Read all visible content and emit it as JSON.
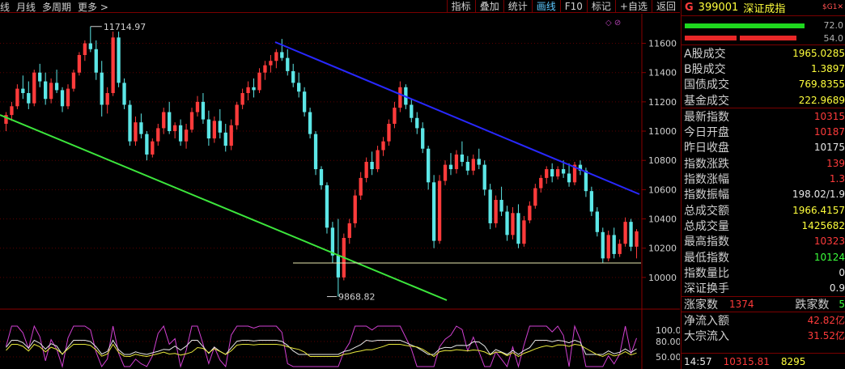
{
  "toolbar": {
    "left_items": [
      "线",
      "月线",
      "多周期",
      "更多 >"
    ],
    "right_buttons": [
      "指标",
      "叠加",
      "统计",
      "画线",
      "F10",
      "标记",
      "+自选",
      "返回"
    ],
    "active_button": "画线"
  },
  "chart": {
    "corner_glyph": "◇ ⊘",
    "high_label": "11714.97",
    "low_label": "9868.82",
    "price_axis": [
      "11600",
      "11400",
      "11200",
      "11000",
      "10800",
      "10600",
      "10400",
      "10200",
      "10000"
    ],
    "indicator_axis": [
      "100.00",
      "80.00",
      "50.00"
    ],
    "colors": {
      "up": "#ff3b3b",
      "down": "#5ce6e6",
      "trend_blue": "#2828ff",
      "trend_green": "#3ce63c",
      "support": "#e8e8b0"
    }
  },
  "chart_data": {
    "type": "candlestick",
    "title": "",
    "ylim": [
      9800,
      11780
    ],
    "candles": [
      {
        "o": 11050,
        "h": 11130,
        "l": 11000,
        "c": 11110
      },
      {
        "o": 11110,
        "h": 11200,
        "l": 11070,
        "c": 11170
      },
      {
        "o": 11170,
        "h": 11320,
        "l": 11150,
        "c": 11290
      },
      {
        "o": 11290,
        "h": 11380,
        "l": 11220,
        "c": 11260
      },
      {
        "o": 11260,
        "h": 11340,
        "l": 11150,
        "c": 11190
      },
      {
        "o": 11190,
        "h": 11420,
        "l": 11170,
        "c": 11400
      },
      {
        "o": 11400,
        "h": 11460,
        "l": 11300,
        "c": 11340
      },
      {
        "o": 11340,
        "h": 11400,
        "l": 11180,
        "c": 11220
      },
      {
        "o": 11220,
        "h": 11360,
        "l": 11190,
        "c": 11330
      },
      {
        "o": 11330,
        "h": 11420,
        "l": 11260,
        "c": 11280
      },
      {
        "o": 11280,
        "h": 11300,
        "l": 11130,
        "c": 11170
      },
      {
        "o": 11170,
        "h": 11320,
        "l": 11150,
        "c": 11290
      },
      {
        "o": 11290,
        "h": 11420,
        "l": 11270,
        "c": 11400
      },
      {
        "o": 11400,
        "h": 11540,
        "l": 11380,
        "c": 11520
      },
      {
        "o": 11520,
        "h": 11620,
        "l": 11480,
        "c": 11600
      },
      {
        "o": 11600,
        "h": 11715,
        "l": 11540,
        "c": 11560
      },
      {
        "o": 11560,
        "h": 11620,
        "l": 11350,
        "c": 11400
      },
      {
        "o": 11400,
        "h": 11480,
        "l": 11100,
        "c": 11180
      },
      {
        "o": 11180,
        "h": 11300,
        "l": 11120,
        "c": 11260
      },
      {
        "o": 11260,
        "h": 11680,
        "l": 11240,
        "c": 11640
      },
      {
        "o": 11640,
        "h": 11680,
        "l": 11300,
        "c": 11330
      },
      {
        "o": 11330,
        "h": 11360,
        "l": 11150,
        "c": 11180
      },
      {
        "o": 11180,
        "h": 11210,
        "l": 10900,
        "c": 10930
      },
      {
        "o": 10930,
        "h": 11100,
        "l": 10900,
        "c": 11060
      },
      {
        "o": 11060,
        "h": 11120,
        "l": 10950,
        "c": 10980
      },
      {
        "o": 10980,
        "h": 11000,
        "l": 10800,
        "c": 10840
      },
      {
        "o": 10840,
        "h": 10950,
        "l": 10820,
        "c": 10930
      },
      {
        "o": 10930,
        "h": 11050,
        "l": 10900,
        "c": 11020
      },
      {
        "o": 11020,
        "h": 11160,
        "l": 10980,
        "c": 11130
      },
      {
        "o": 11130,
        "h": 11200,
        "l": 10980,
        "c": 11000
      },
      {
        "o": 11000,
        "h": 11060,
        "l": 10950,
        "c": 11040
      },
      {
        "o": 11040,
        "h": 11080,
        "l": 10900,
        "c": 10930
      },
      {
        "o": 10930,
        "h": 11050,
        "l": 10880,
        "c": 11010
      },
      {
        "o": 11010,
        "h": 11160,
        "l": 10990,
        "c": 11130
      },
      {
        "o": 11130,
        "h": 11240,
        "l": 11100,
        "c": 11200
      },
      {
        "o": 11200,
        "h": 11260,
        "l": 11050,
        "c": 11080
      },
      {
        "o": 11080,
        "h": 11140,
        "l": 10900,
        "c": 10950
      },
      {
        "o": 10950,
        "h": 11100,
        "l": 10920,
        "c": 11070
      },
      {
        "o": 11070,
        "h": 11150,
        "l": 10950,
        "c": 10990
      },
      {
        "o": 10990,
        "h": 11050,
        "l": 10860,
        "c": 10900
      },
      {
        "o": 10900,
        "h": 11080,
        "l": 10870,
        "c": 11040
      },
      {
        "o": 11040,
        "h": 11200,
        "l": 11010,
        "c": 11180
      },
      {
        "o": 11180,
        "h": 11290,
        "l": 11150,
        "c": 11260
      },
      {
        "o": 11260,
        "h": 11340,
        "l": 11210,
        "c": 11300
      },
      {
        "o": 11300,
        "h": 11360,
        "l": 11230,
        "c": 11280
      },
      {
        "o": 11280,
        "h": 11430,
        "l": 11260,
        "c": 11400
      },
      {
        "o": 11400,
        "h": 11480,
        "l": 11350,
        "c": 11450
      },
      {
        "o": 11450,
        "h": 11520,
        "l": 11400,
        "c": 11480
      },
      {
        "o": 11480,
        "h": 11560,
        "l": 11430,
        "c": 11540
      },
      {
        "o": 11540,
        "h": 11630,
        "l": 11480,
        "c": 11500
      },
      {
        "o": 11500,
        "h": 11560,
        "l": 11380,
        "c": 11410
      },
      {
        "o": 11410,
        "h": 11460,
        "l": 11300,
        "c": 11330
      },
      {
        "o": 11330,
        "h": 11400,
        "l": 11230,
        "c": 11270
      },
      {
        "o": 11270,
        "h": 11300,
        "l": 11100,
        "c": 11130
      },
      {
        "o": 11130,
        "h": 11160,
        "l": 10950,
        "c": 10980
      },
      {
        "o": 10980,
        "h": 11000,
        "l": 10700,
        "c": 10740
      },
      {
        "o": 10740,
        "h": 10760,
        "l": 10600,
        "c": 10630
      },
      {
        "o": 10630,
        "h": 10650,
        "l": 10300,
        "c": 10340
      },
      {
        "o": 10340,
        "h": 10380,
        "l": 10100,
        "c": 10150
      },
      {
        "o": 10150,
        "h": 10400,
        "l": 9869,
        "c": 10000
      },
      {
        "o": 10000,
        "h": 10300,
        "l": 9980,
        "c": 10270
      },
      {
        "o": 10270,
        "h": 10400,
        "l": 10230,
        "c": 10370
      },
      {
        "o": 10370,
        "h": 10600,
        "l": 10340,
        "c": 10560
      },
      {
        "o": 10560,
        "h": 10720,
        "l": 10530,
        "c": 10680
      },
      {
        "o": 10680,
        "h": 10820,
        "l": 10650,
        "c": 10790
      },
      {
        "o": 10790,
        "h": 10860,
        "l": 10700,
        "c": 10740
      },
      {
        "o": 10740,
        "h": 10900,
        "l": 10720,
        "c": 10870
      },
      {
        "o": 10870,
        "h": 10960,
        "l": 10830,
        "c": 10930
      },
      {
        "o": 10930,
        "h": 11080,
        "l": 10900,
        "c": 11050
      },
      {
        "o": 11050,
        "h": 11200,
        "l": 11020,
        "c": 11160
      },
      {
        "o": 11160,
        "h": 11340,
        "l": 11130,
        "c": 11300
      },
      {
        "o": 11300,
        "h": 11320,
        "l": 11150,
        "c": 11180
      },
      {
        "o": 11180,
        "h": 11220,
        "l": 11060,
        "c": 11090
      },
      {
        "o": 11090,
        "h": 11130,
        "l": 10980,
        "c": 11020
      },
      {
        "o": 11020,
        "h": 11060,
        "l": 10850,
        "c": 10880
      },
      {
        "o": 10880,
        "h": 10900,
        "l": 10600,
        "c": 10650
      },
      {
        "o": 10650,
        "h": 10700,
        "l": 10200,
        "c": 10250
      },
      {
        "o": 10250,
        "h": 10700,
        "l": 10230,
        "c": 10660
      },
      {
        "o": 10660,
        "h": 10800,
        "l": 10630,
        "c": 10770
      },
      {
        "o": 10770,
        "h": 10850,
        "l": 10700,
        "c": 10740
      },
      {
        "o": 10740,
        "h": 10870,
        "l": 10710,
        "c": 10840
      },
      {
        "o": 10840,
        "h": 10930,
        "l": 10760,
        "c": 10790
      },
      {
        "o": 10790,
        "h": 10830,
        "l": 10700,
        "c": 10730
      },
      {
        "o": 10730,
        "h": 10840,
        "l": 10700,
        "c": 10810
      },
      {
        "o": 10810,
        "h": 10880,
        "l": 10740,
        "c": 10770
      },
      {
        "o": 10770,
        "h": 10800,
        "l": 10560,
        "c": 10600
      },
      {
        "o": 10600,
        "h": 10640,
        "l": 10330,
        "c": 10370
      },
      {
        "o": 10370,
        "h": 10560,
        "l": 10340,
        "c": 10530
      },
      {
        "o": 10530,
        "h": 10620,
        "l": 10420,
        "c": 10450
      },
      {
        "o": 10450,
        "h": 10490,
        "l": 10250,
        "c": 10290
      },
      {
        "o": 10290,
        "h": 10480,
        "l": 10260,
        "c": 10440
      },
      {
        "o": 10440,
        "h": 10500,
        "l": 10200,
        "c": 10230
      },
      {
        "o": 10230,
        "h": 10420,
        "l": 10210,
        "c": 10390
      },
      {
        "o": 10390,
        "h": 10520,
        "l": 10370,
        "c": 10490
      },
      {
        "o": 10490,
        "h": 10640,
        "l": 10470,
        "c": 10610
      },
      {
        "o": 10610,
        "h": 10700,
        "l": 10580,
        "c": 10680
      },
      {
        "o": 10680,
        "h": 10760,
        "l": 10640,
        "c": 10740
      },
      {
        "o": 10740,
        "h": 10780,
        "l": 10650,
        "c": 10690
      },
      {
        "o": 10690,
        "h": 10760,
        "l": 10670,
        "c": 10740
      },
      {
        "o": 10740,
        "h": 10800,
        "l": 10680,
        "c": 10710
      },
      {
        "o": 10710,
        "h": 10780,
        "l": 10620,
        "c": 10650
      },
      {
        "o": 10650,
        "h": 10790,
        "l": 10630,
        "c": 10770
      },
      {
        "o": 10770,
        "h": 10800,
        "l": 10700,
        "c": 10730
      },
      {
        "o": 10730,
        "h": 10750,
        "l": 10550,
        "c": 10590
      },
      {
        "o": 10590,
        "h": 10620,
        "l": 10420,
        "c": 10450
      },
      {
        "o": 10450,
        "h": 10480,
        "l": 10280,
        "c": 10310
      },
      {
        "o": 10310,
        "h": 10340,
        "l": 10100,
        "c": 10130
      },
      {
        "o": 10130,
        "h": 10320,
        "l": 10110,
        "c": 10290
      },
      {
        "o": 10290,
        "h": 10340,
        "l": 10130,
        "c": 10160
      },
      {
        "o": 10160,
        "h": 10260,
        "l": 10140,
        "c": 10230
      },
      {
        "o": 10230,
        "h": 10410,
        "l": 10210,
        "c": 10380
      },
      {
        "o": 10380,
        "h": 10400,
        "l": 10180,
        "c": 10210
      },
      {
        "o": 10210,
        "h": 10330,
        "l": 10130,
        "c": 10315
      }
    ]
  },
  "panel": {
    "header": {
      "letter": "G",
      "code": "399001",
      "name": "深证成指",
      "tag": "$G1✕"
    },
    "bar_pcts": [
      "72.0",
      "54.0"
    ],
    "volume_rows": [
      {
        "label": "A股成交",
        "value": "1965.0285",
        "color": "yellow"
      },
      {
        "label": "B股成交",
        "value": "1.3897",
        "color": "yellow"
      },
      {
        "label": "国债成交",
        "value": "769.8355",
        "color": "yellow"
      },
      {
        "label": "基金成交",
        "value": "222.9689",
        "color": "yellow"
      }
    ],
    "index_rows": [
      {
        "label": "最新指数",
        "value": "10315",
        "color": "red"
      },
      {
        "label": "今日开盘",
        "value": "10187",
        "color": "red"
      },
      {
        "label": "昨日收盘",
        "value": "10175",
        "color": "white"
      },
      {
        "label": "指数涨跌",
        "value": "139",
        "color": "red"
      },
      {
        "label": "指数涨幅",
        "value": "1.3",
        "color": "red"
      },
      {
        "label": "指数振幅",
        "value": "198.02/1.9",
        "color": "white"
      },
      {
        "label": "总成交额",
        "value": "1966.4157",
        "color": "yellow"
      },
      {
        "label": "总成交量",
        "value": "1425682",
        "color": "yellow"
      },
      {
        "label": "最高指数",
        "value": "10323",
        "color": "red"
      },
      {
        "label": "最低指数",
        "value": "10124",
        "color": "green"
      },
      {
        "label": "指数量比",
        "value": "0",
        "color": "white"
      },
      {
        "label": "深证换手",
        "value": "0.9",
        "color": "white"
      }
    ],
    "breadth": {
      "up_label": "涨家数",
      "up_value": "1374",
      "down_label": "跌家数",
      "down_value": "5"
    },
    "flow_rows": [
      {
        "label": "净流入额",
        "value": "42.82亿",
        "color": "red"
      },
      {
        "label": "大宗流入",
        "value": "31.52亿",
        "color": "red"
      }
    ],
    "footer": {
      "time": "14:57",
      "price": "10315.81",
      "volume": "8295"
    }
  }
}
